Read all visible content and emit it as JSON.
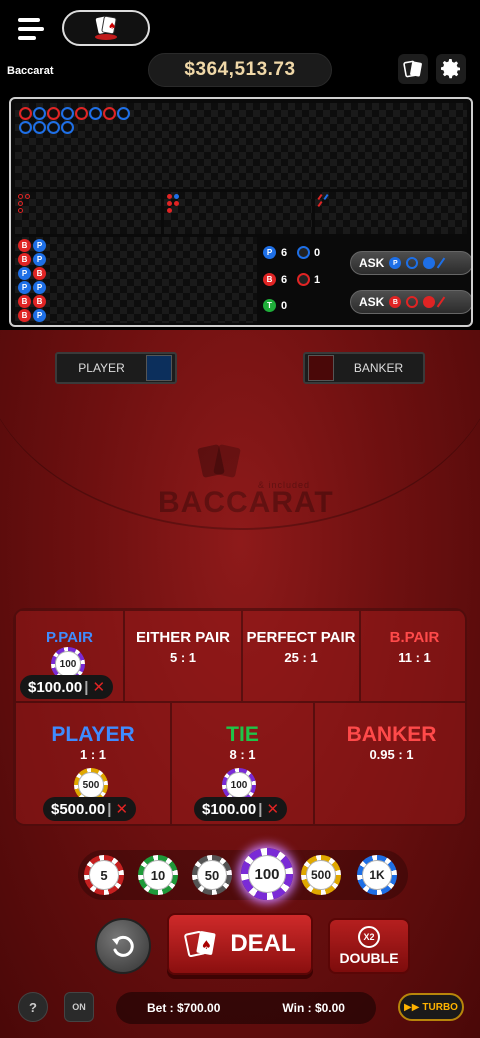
{
  "header": {
    "game_name": "Baccarat",
    "balance": "$364,513.73"
  },
  "stats": {
    "player_count": "6",
    "banker_count": "6",
    "tie_count": "0",
    "player_pair_count": "0",
    "banker_pair_count": "1",
    "player_letter": "P",
    "banker_letter": "B",
    "tie_letter": "T"
  },
  "ask": {
    "player_label": "ASK",
    "banker_label": "ASK"
  },
  "side_boxes": {
    "player_label": "PLAYER",
    "banker_label": "BANKER"
  },
  "watermark": {
    "text": "BACCARAT",
    "small": "& included"
  },
  "bets": {
    "p_pair": {
      "label": "P.PAIR",
      "stake": "$100.00",
      "chip": "100"
    },
    "either_pair": {
      "label": "EITHER PAIR",
      "odds": "5 : 1"
    },
    "perfect_pair": {
      "label": "PERFECT PAIR",
      "odds": "25 : 1"
    },
    "b_pair": {
      "label": "B.PAIR",
      "odds": "11 : 1"
    },
    "player": {
      "label": "PLAYER",
      "odds": "1 : 1",
      "stake": "$500.00",
      "chip": "500"
    },
    "tie": {
      "label": "TIE",
      "odds": "8 : 1",
      "stake": "$100.00",
      "chip": "100"
    },
    "banker": {
      "label": "BANKER",
      "odds": "0.95 : 1"
    }
  },
  "chips": [
    "5",
    "10",
    "50",
    "100",
    "500",
    "1K"
  ],
  "controls": {
    "deal_label": "DEAL",
    "double_label": "DOUBLE",
    "double_badge": "X2",
    "turbo_label": "TURBO",
    "auto_label": "ON"
  },
  "footer": {
    "bet_text": "Bet : $700.00",
    "win_text": "Win : $0.00"
  },
  "colors": {
    "player_blue": "#1e6fe6",
    "banker_red": "#e02424",
    "tie_green": "#1fae3a",
    "pair_label_red": "#ff4a4a",
    "balance_gold": "#f0d8a8"
  }
}
